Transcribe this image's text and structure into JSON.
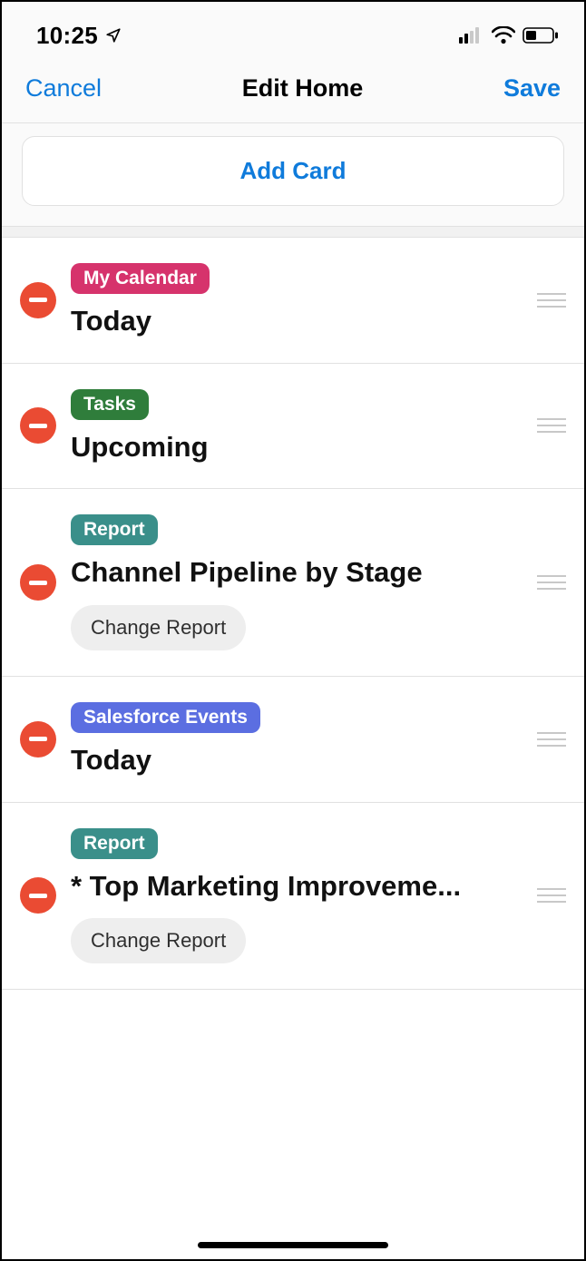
{
  "status": {
    "time": "10:25"
  },
  "nav": {
    "cancel": "Cancel",
    "title": "Edit Home",
    "save": "Save"
  },
  "add_card_label": "Add Card",
  "tags": {
    "my_calendar": {
      "label": "My Calendar",
      "color": "#d6336c"
    },
    "tasks": {
      "label": "Tasks",
      "color": "#2f7d3b"
    },
    "report": {
      "label": "Report",
      "color": "#3a8f8a"
    },
    "sf_events": {
      "label": "Salesforce Events",
      "color": "#5b6ee1"
    }
  },
  "change_report_label": "Change Report",
  "cards": [
    {
      "tag": "my_calendar",
      "title": "Today",
      "has_change": false
    },
    {
      "tag": "tasks",
      "title": "Upcoming",
      "has_change": false
    },
    {
      "tag": "report",
      "title": "Channel Pipeline by Stage",
      "has_change": true
    },
    {
      "tag": "sf_events",
      "title": "Today",
      "has_change": false
    },
    {
      "tag": "report",
      "title": "* Top Marketing Improveme...",
      "has_change": true
    }
  ]
}
